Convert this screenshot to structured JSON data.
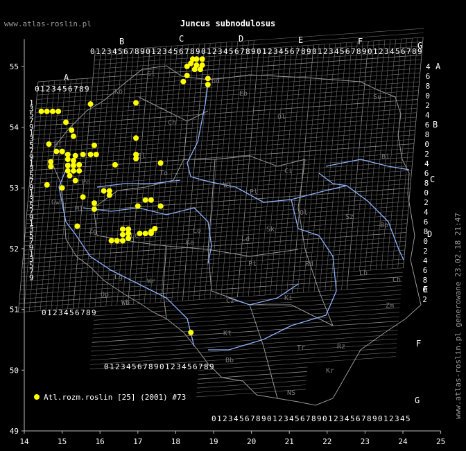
{
  "site": "www.atlas-roslin.pl",
  "title": "Juncus subnodulosus",
  "side_text": "www.atlas-roslin.pl generowane 23.02.18 21:47",
  "legend": {
    "label": "Atl.rozm.roslin [25] (2001) #73",
    "color": "#ffff00"
  },
  "axes": {
    "x_ticks": [
      "14",
      "15",
      "16",
      "17",
      "18",
      "19",
      "20",
      "21",
      "22",
      "23",
      "24",
      "25"
    ],
    "y_ticks": [
      "49",
      "50",
      "51",
      "52",
      "53",
      "54",
      "55"
    ]
  },
  "grid_columns": [
    "A",
    "B",
    "C",
    "D",
    "E",
    "F",
    "G"
  ],
  "grid_rows": [
    "A",
    "B",
    "C",
    "D",
    "E",
    "F",
    "G"
  ],
  "digits": "0123456789",
  "regions": [
    "Sl",
    "Ko",
    "Gd",
    "Eb",
    "Ol",
    "Su",
    "Ch",
    "El",
    "Bi",
    "Gr",
    "Ci",
    "Wl",
    "Pl",
    "To",
    "Ol",
    "Sz",
    "Lo",
    "Bp",
    "Ka",
    "Ld",
    "Sk",
    "Pt",
    "Rd",
    "Lb",
    "Ch",
    "Lg",
    "Wr",
    "Cz",
    "Ki",
    "Zm",
    "Wb",
    "Op",
    "Kt",
    "Tr",
    "Rz",
    "Bb",
    "NS",
    "Kr",
    "Le",
    "Zg",
    "Po",
    "Gw",
    "Mi"
  ],
  "chart_data": {
    "type": "scatter",
    "title": "Juncus subnodulosus",
    "xlim": [
      14,
      25
    ],
    "ylim": [
      49,
      55.5
    ],
    "series": [
      {
        "name": "Atl.rozm.roslin [25] (2001) #73",
        "color": "#ffff00",
        "points": [
          [
            14.45,
            54.26
          ],
          [
            14.6,
            54.26
          ],
          [
            14.75,
            54.26
          ],
          [
            14.9,
            54.26
          ],
          [
            15.75,
            54.38
          ],
          [
            16.95,
            54.4
          ],
          [
            15.1,
            54.08
          ],
          [
            15.25,
            53.95
          ],
          [
            15.3,
            53.85
          ],
          [
            16.95,
            53.82
          ],
          [
            14.65,
            53.72
          ],
          [
            15.85,
            53.7
          ],
          [
            14.85,
            53.6
          ],
          [
            15.0,
            53.6
          ],
          [
            15.15,
            53.55
          ],
          [
            15.35,
            53.53
          ],
          [
            15.55,
            53.55
          ],
          [
            15.75,
            53.55
          ],
          [
            15.9,
            53.55
          ],
          [
            16.95,
            53.55
          ],
          [
            16.95,
            53.48
          ],
          [
            15.15,
            53.47
          ],
          [
            15.3,
            53.45
          ],
          [
            14.7,
            53.43
          ],
          [
            15.15,
            53.37
          ],
          [
            15.3,
            53.37
          ],
          [
            15.45,
            53.38
          ],
          [
            16.4,
            53.38
          ],
          [
            17.6,
            53.41
          ],
          [
            14.7,
            53.35
          ],
          [
            15.15,
            53.28
          ],
          [
            15.3,
            53.28
          ],
          [
            15.45,
            53.28
          ],
          [
            15.2,
            53.2
          ],
          [
            15.35,
            53.12
          ],
          [
            14.6,
            53.05
          ],
          [
            15.0,
            53.0
          ],
          [
            16.1,
            52.95
          ],
          [
            16.25,
            52.95
          ],
          [
            16.25,
            52.88
          ],
          [
            15.55,
            52.85
          ],
          [
            17.2,
            52.8
          ],
          [
            17.35,
            52.8
          ],
          [
            15.85,
            52.75
          ],
          [
            17.0,
            52.7
          ],
          [
            17.6,
            52.7
          ],
          [
            15.85,
            52.65
          ],
          [
            15.4,
            52.37
          ],
          [
            16.6,
            52.32
          ],
          [
            16.75,
            52.32
          ],
          [
            17.45,
            52.33
          ],
          [
            17.35,
            52.28
          ],
          [
            16.6,
            52.23
          ],
          [
            16.75,
            52.25
          ],
          [
            17.05,
            52.25
          ],
          [
            17.2,
            52.25
          ],
          [
            17.35,
            52.25
          ],
          [
            16.3,
            52.13
          ],
          [
            16.45,
            52.13
          ],
          [
            16.6,
            52.13
          ],
          [
            16.75,
            52.17
          ],
          [
            18.2,
            54.75
          ],
          [
            18.3,
            54.85
          ],
          [
            18.3,
            55.0
          ],
          [
            18.4,
            55.05
          ],
          [
            18.45,
            55.12
          ],
          [
            18.55,
            55.12
          ],
          [
            18.7,
            55.12
          ],
          [
            18.55,
            55.02
          ],
          [
            18.7,
            55.02
          ],
          [
            18.5,
            54.95
          ],
          [
            18.65,
            54.95
          ],
          [
            18.85,
            54.8
          ],
          [
            18.85,
            54.7
          ],
          [
            18.4,
            50.62
          ]
        ]
      }
    ]
  }
}
